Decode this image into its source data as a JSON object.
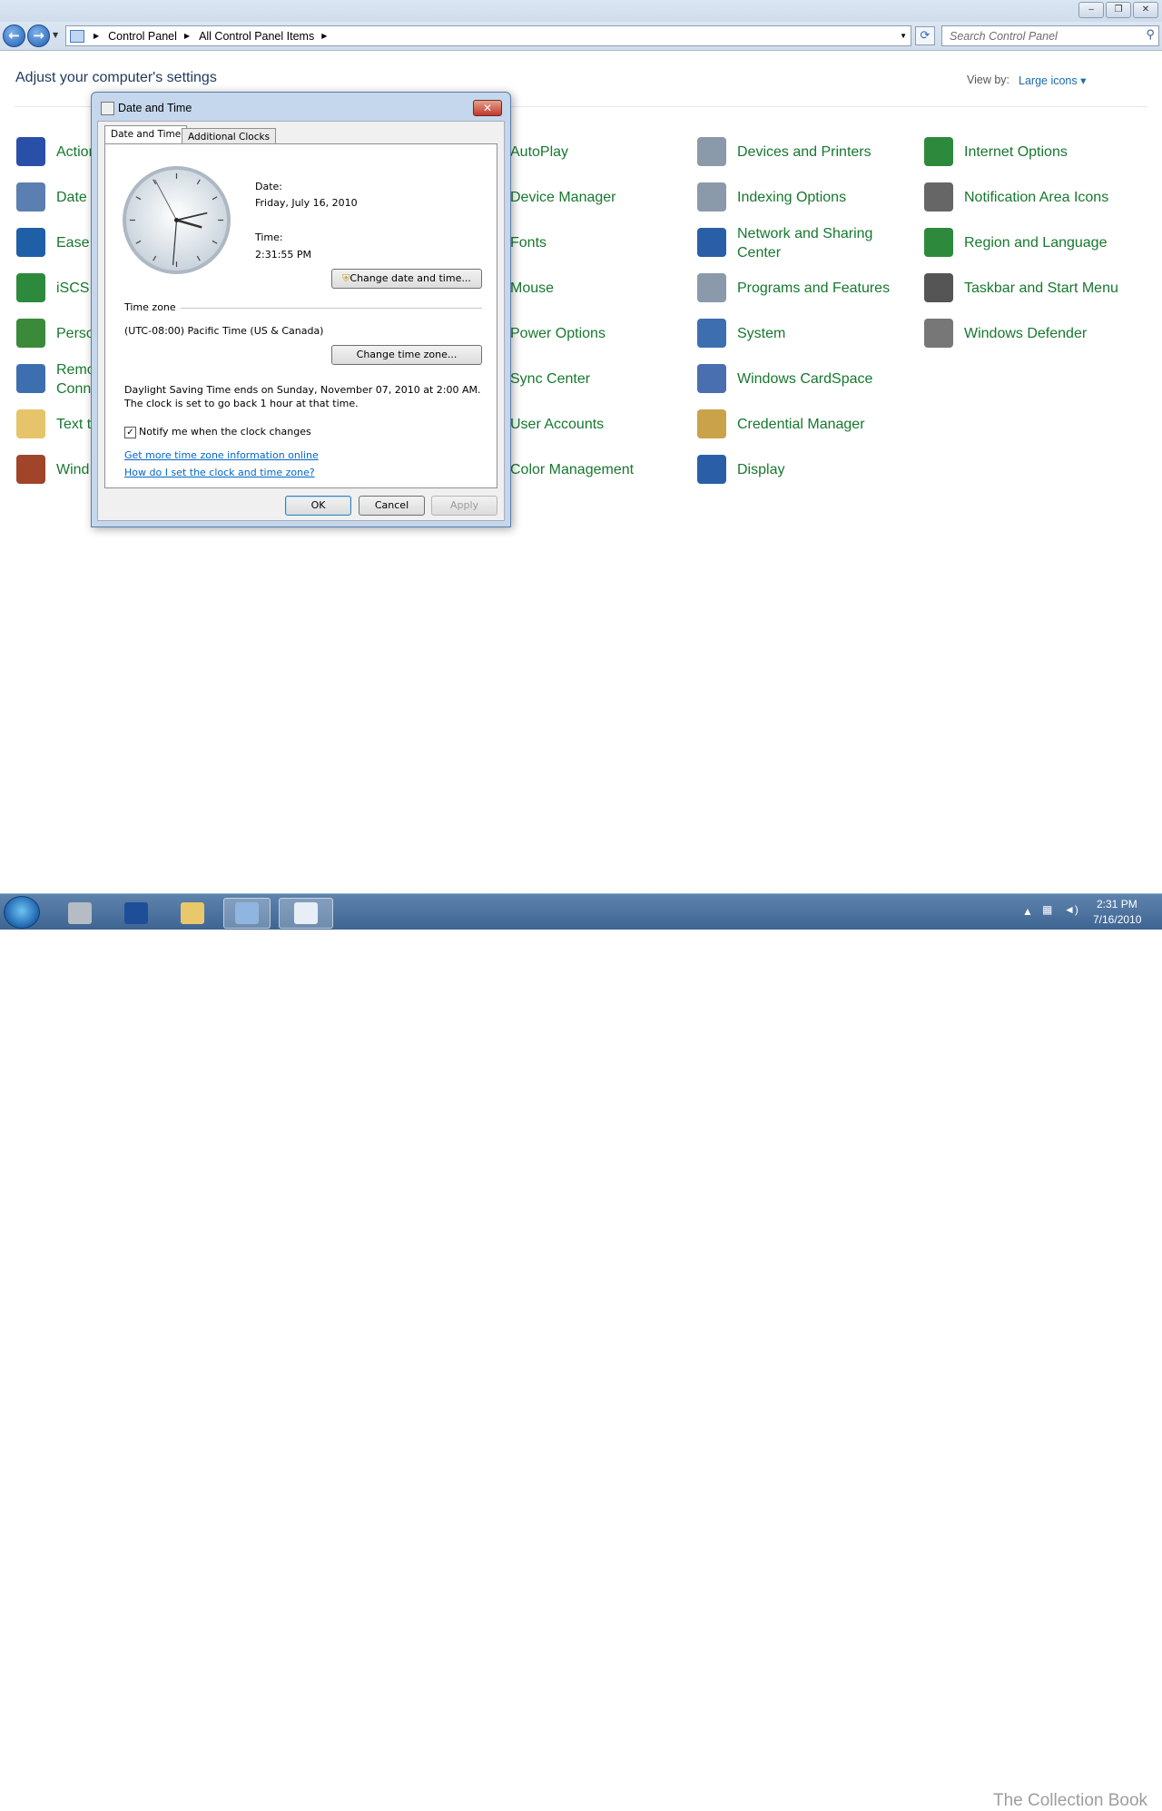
{
  "window": {
    "minimize": "‒",
    "restore": "❐",
    "close": "✕"
  },
  "address": {
    "back": "←",
    "forward": "→",
    "crumbs": [
      "Control Panel",
      "All Control Panel Items"
    ],
    "search_placeholder": "Search Control Panel"
  },
  "header": {
    "title": "Adjust your computer's settings",
    "view_by_label": "View by:",
    "view_by_value": "Large icons"
  },
  "items": [
    {
      "label": "Action Center",
      "visible": "Action",
      "icon": "flag-icon",
      "color": "#2a4fa8"
    },
    {
      "label": "Date and Time",
      "visible": "Date a",
      "icon": "calendar-clock-icon",
      "color": "#5b7fb0"
    },
    {
      "label": "Ease of Access Center",
      "visible": "Ease c",
      "icon": "ease-of-access-icon",
      "color": "#1f5fa8"
    },
    {
      "label": "iSCSI Initiator",
      "visible": "iSCSI",
      "icon": "globe-shield-icon",
      "color": "#2d8a3d"
    },
    {
      "label": "Personalization",
      "visible": "Perso",
      "icon": "monitor-icon",
      "color": "#3a8a3a"
    },
    {
      "label": "Remote Connections",
      "visible": "Remo\nConn",
      "icon": "remote-app-icon",
      "color": "#3d6fb0"
    },
    {
      "label": "Text to Speech",
      "visible": "Text t",
      "icon": "speech-bubble-icon",
      "color": "#e6c46a"
    },
    {
      "label": "Windows Firewall",
      "visible": "Wind",
      "icon": "firewall-icon",
      "color": "#a0452a"
    },
    {
      "label": "AutoPlay",
      "icon": "autoplay-icon",
      "color": "#3a7d3a"
    },
    {
      "label": "Device Manager",
      "icon": "device-manager-icon",
      "color": "#4a6fa0"
    },
    {
      "label": "Fonts",
      "icon": "fonts-icon",
      "color": "#d4b050"
    },
    {
      "label": "Mouse",
      "icon": "mouse-icon",
      "color": "#777777"
    },
    {
      "label": "Power Options",
      "icon": "power-icon",
      "color": "#3a8a3a"
    },
    {
      "label": "Sync Center",
      "icon": "sync-icon",
      "color": "#3a8a3a"
    },
    {
      "label": "User Accounts",
      "icon": "users-icon",
      "color": "#3d6fb0"
    },
    {
      "label": "Color Management",
      "icon": "color-management-icon",
      "color": "#4d8fd8"
    },
    {
      "label": "Devices and Printers",
      "icon": "printer-icon",
      "color": "#8a9aaa"
    },
    {
      "label": "Indexing Options",
      "icon": "indexing-icon",
      "color": "#8a9aaa"
    },
    {
      "label": "Network and Sharing\nCenter",
      "icon": "network-icon",
      "color": "#2a5fa8"
    },
    {
      "label": "Programs and Features",
      "icon": "programs-icon",
      "color": "#8a9aaa"
    },
    {
      "label": "System",
      "icon": "system-icon",
      "color": "#3d6fb0"
    },
    {
      "label": "Windows CardSpace",
      "icon": "cardspace-icon",
      "color": "#4a6fb0"
    },
    {
      "label": "Credential Manager",
      "icon": "credential-vault-icon",
      "color": "#c9a24a"
    },
    {
      "label": "Display",
      "icon": "display-icon",
      "color": "#2a5fa8"
    },
    {
      "label": "Internet Options",
      "icon": "internet-options-icon",
      "color": "#2d8a3d"
    },
    {
      "label": "Notification Area Icons",
      "icon": "notification-area-icon",
      "color": "#666666"
    },
    {
      "label": "Region and Language",
      "icon": "region-globe-icon",
      "color": "#2d8a3d"
    },
    {
      "label": "Taskbar and Start Menu",
      "icon": "taskbar-icon",
      "color": "#555555"
    },
    {
      "label": "Windows Defender",
      "icon": "defender-icon",
      "color": "#777777"
    }
  ],
  "dialog": {
    "title": "Date and Time",
    "close": "✕",
    "tabs": [
      "Date and Time",
      "Additional Clocks"
    ],
    "date_label": "Date:",
    "date_value": "Friday, July 16, 2010",
    "time_label": "Time:",
    "time_value": "2:31:55 PM",
    "change_datetime": "Change date and time...",
    "timezone_label": "Time zone",
    "timezone_value": "(UTC-08:00) Pacific Time (US & Canada)",
    "change_timezone": "Change time zone...",
    "dst_note": "Daylight Saving Time ends on Sunday, November 07, 2010 at 2:00 AM. The clock is set to go back 1 hour at that time.",
    "notify_label": "Notify me when the clock changes",
    "notify_checked": true,
    "link_more": "Get more time zone information online",
    "link_howto": "How do I set the clock and time zone?",
    "ok": "OK",
    "cancel": "Cancel",
    "apply": "Apply"
  },
  "taskbar": {
    "items": [
      "server-manager-icon",
      "powershell-icon",
      "explorer-folder-icon",
      "control-panel-icon",
      "date-time-icon"
    ],
    "tray_time": "2:31 PM",
    "tray_date": "7/16/2010",
    "watermark": "The Collection Book"
  }
}
